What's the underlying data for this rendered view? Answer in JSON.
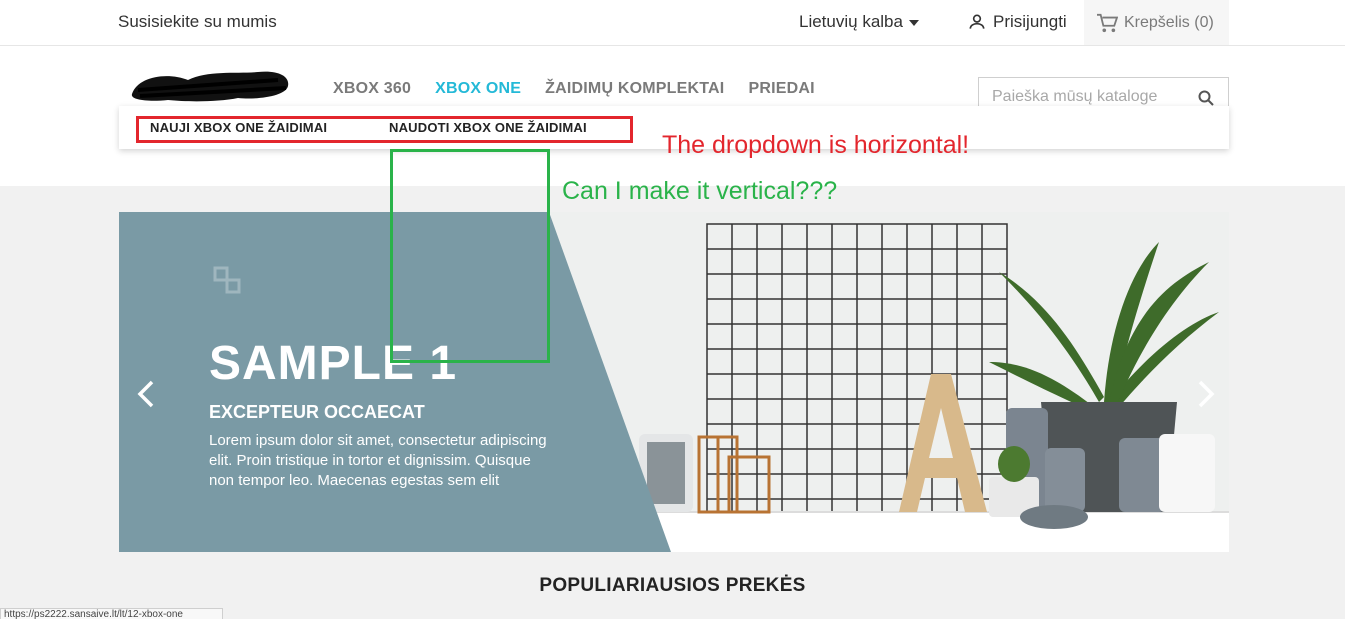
{
  "topbar": {
    "contact": "Susisiekite su mumis",
    "language": "Lietuvių kalba",
    "login": "Prisijungti",
    "cart": "Krepšelis (0)"
  },
  "nav": {
    "items": [
      {
        "label": "XBOX 360",
        "active": false
      },
      {
        "label": "XBOX ONE",
        "active": true
      },
      {
        "label": "ŽAIDIMŲ KOMPLEKTAI",
        "active": false
      },
      {
        "label": "PRIEDAI",
        "active": false
      }
    ],
    "accent_color": "#24b9d7"
  },
  "search": {
    "placeholder": "Paieška mūsų kataloge"
  },
  "dropdown": {
    "items": [
      "NAUJI XBOX ONE ŽAIDIMAI",
      "NAUDOTI XBOX ONE ŽAIDIMAI"
    ]
  },
  "annotations": {
    "red_note": "The dropdown is horizontal!",
    "green_note": "Can I make it vertical???",
    "red_color": "#e3262d",
    "green_color": "#2ab34a"
  },
  "slider": {
    "title": "SAMPLE 1",
    "subtitle": "EXCEPTEUR OCCAECAT",
    "description": "Lorem ipsum dolor sit amet, consectetur adipiscing elit. Proin tristique in tortor et dignissim. Quisque non tempor leo. Maecenas egestas sem elit",
    "panel_color": "#7a9aa5"
  },
  "section": {
    "title": "POPULIARIAUSIOS PREKĖS"
  },
  "statusbar": {
    "url": "https://ps2222.sansaive.lt/lt/12-xbox-one"
  }
}
